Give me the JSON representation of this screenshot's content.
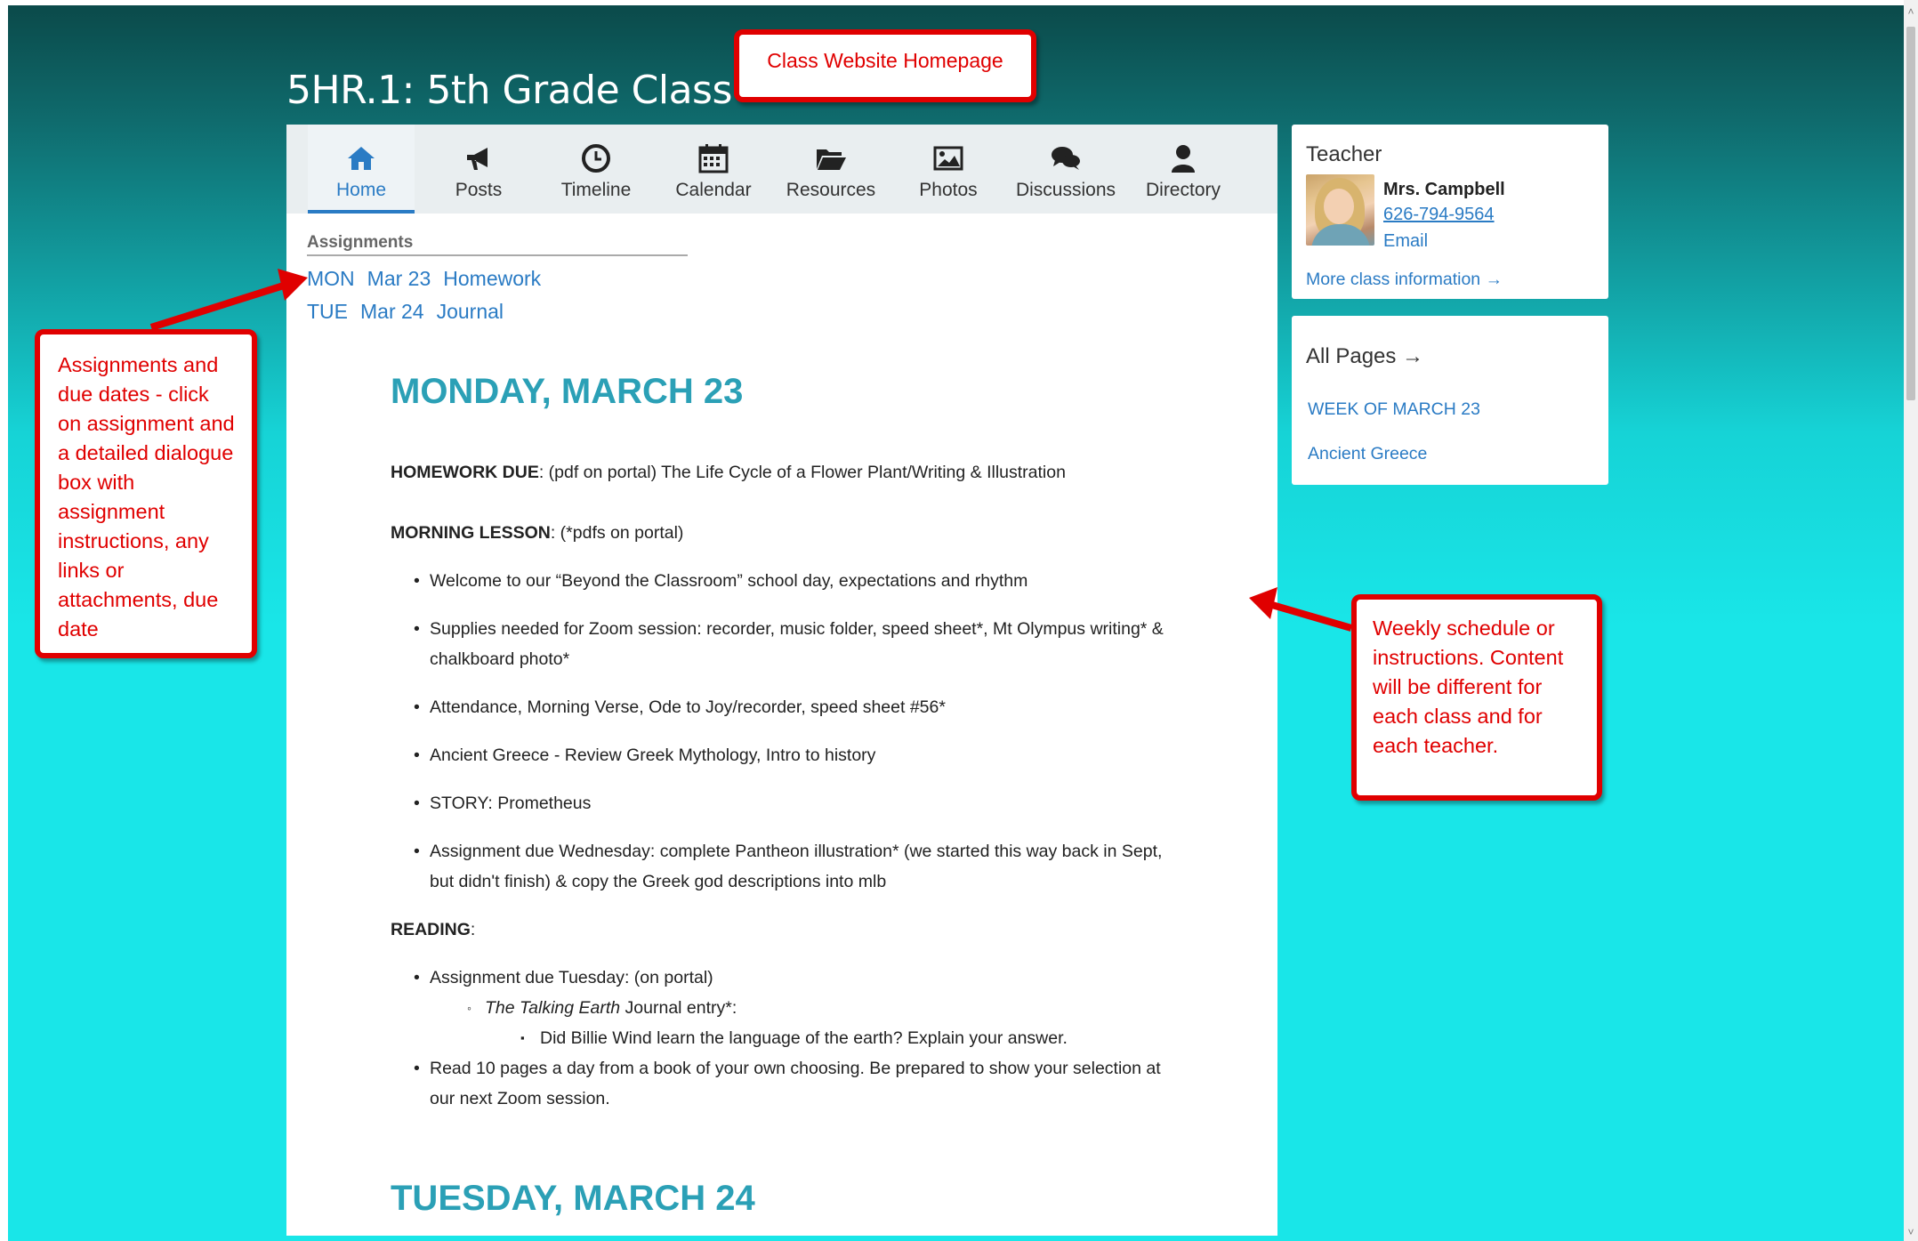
{
  "class_title": "5HR.1: 5th Grade Class",
  "nav": {
    "items": [
      {
        "label": "Home",
        "icon": "home-icon",
        "active": true
      },
      {
        "label": "Posts",
        "icon": "megaphone-icon"
      },
      {
        "label": "Timeline",
        "icon": "clock-icon"
      },
      {
        "label": "Calendar",
        "icon": "calendar-icon"
      },
      {
        "label": "Resources",
        "icon": "folder-open-icon"
      },
      {
        "label": "Photos",
        "icon": "image-icon"
      },
      {
        "label": "Discussions",
        "icon": "chat-bubbles-icon"
      },
      {
        "label": "Directory",
        "icon": "person-icon"
      }
    ]
  },
  "assignments": {
    "heading": "Assignments",
    "items": [
      {
        "day": "MON",
        "date": "Mar 23",
        "title": "Homework"
      },
      {
        "day": "TUE",
        "date": "Mar 24",
        "title": "Journal"
      }
    ]
  },
  "content": {
    "day1_heading": "MONDAY, MARCH 23",
    "homework_label": "HOMEWORK DUE",
    "homework_text": ": (pdf on portal) The Life Cycle of a Flower Plant/Writing & Illustration",
    "morning_label": "MORNING LESSON",
    "morning_text": ": (*pdfs on portal)",
    "morning_bullets": [
      "Welcome to our “Beyond the Classroom” school day, expectations and rhythm",
      "Supplies needed for Zoom session: recorder, music folder, speed sheet*, Mt Olympus writing* & chalkboard photo*",
      "Attendance, Morning Verse, Ode to Joy/recorder, speed sheet #56*",
      "Ancient Greece - Review Greek Mythology, Intro to history",
      "STORY: Prometheus",
      "Assignment due Wednesday: complete Pantheon illustration* (we started this way back in Sept, but didn't finish) & copy the Greek god descriptions into mlb"
    ],
    "reading_label": "READING",
    "reading_colon": ":",
    "reading_bullet1": "Assignment due Tuesday: (on portal)",
    "reading_sub1_italic": "The Talking Earth",
    "reading_sub1_rest": " Journal entry*:",
    "reading_sub2": "Did Billie Wind learn the language of the earth? Explain your answer.",
    "reading_bullet2": "Read 10 pages a day from a book of your own choosing. Be prepared to show your selection at our next Zoom session.",
    "day2_heading": "TUESDAY, MARCH 24"
  },
  "teacher": {
    "title": "Teacher",
    "name": "Mrs. Campbell",
    "phone": "626-794-9564",
    "email_label": "Email",
    "more_info": "More class information →"
  },
  "all_pages": {
    "title": "All Pages →",
    "links": [
      "WEEK OF MARCH 23",
      "Ancient Greece"
    ]
  },
  "callouts": {
    "top": "Class Website Homepage",
    "left": "Assignments and due dates - click on assignment and a detailed dialogue box with assignment instructions, any links or attachments, due date",
    "right": "Weekly schedule or instructions. Content will be different for each class and for each teacher."
  },
  "colors": {
    "accent_blue": "#2a7bc4",
    "heading_teal": "#2ba0b6",
    "callout_red": "#e00000",
    "background_cyan": "#19e6e8"
  }
}
